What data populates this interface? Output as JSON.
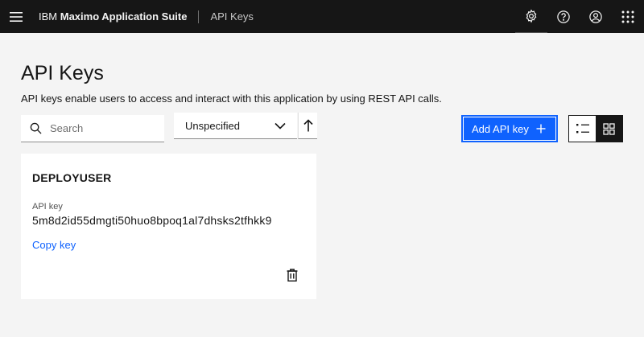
{
  "header": {
    "brand_prefix": "IBM",
    "brand_name": "Maximo Application Suite",
    "breadcrumb": "API Keys",
    "icons": [
      "menu-icon",
      "settings-icon",
      "help-icon",
      "user-avatar-icon",
      "app-switcher-icon"
    ]
  },
  "page": {
    "title": "API Keys",
    "description": "API keys enable users to access and interact with this application by using REST API calls."
  },
  "toolbar": {
    "search_placeholder": "Search",
    "sort_value": "Unspecified",
    "add_button_label": "Add API key",
    "view_modes": [
      "list",
      "grid"
    ],
    "active_view": "grid"
  },
  "cards": [
    {
      "user": "DEPLOYUSER",
      "key_label": "API key",
      "key_value": "5m8d2id55dmgti50huo8bpoq1al7dhsks2tfhkk9",
      "copy_label": "Copy key"
    }
  ],
  "colors": {
    "header_bg": "#161616",
    "page_bg": "#f4f4f4",
    "primary": "#0f62fe",
    "link": "#0f62fe"
  }
}
